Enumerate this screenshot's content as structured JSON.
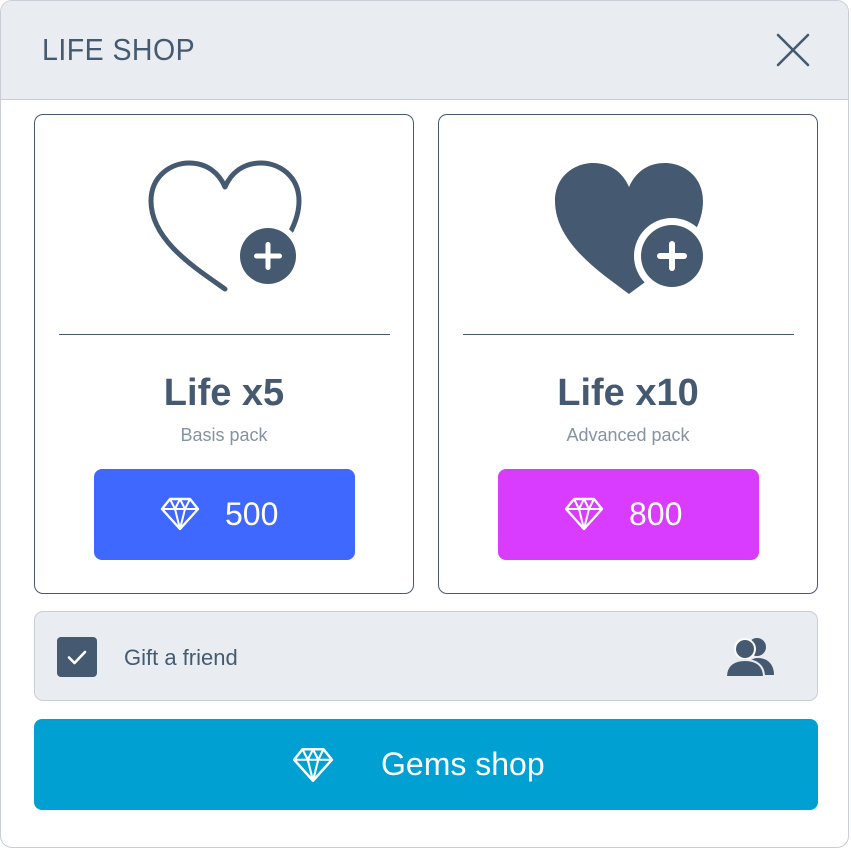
{
  "dialog": {
    "title": "LIFE SHOP",
    "close_icon": "close-icon"
  },
  "colors": {
    "header_bg": "#e9edf2",
    "text_primary": "#455a70",
    "text_muted": "#8593a3",
    "basis_button": "#3e68ff",
    "advanced_button": "#d93bff",
    "gems_button": "#00a0d2"
  },
  "packs": [
    {
      "name": "Life x5",
      "subtitle": "Basis pack",
      "price": "500",
      "icon": "heart-outline-plus-icon",
      "currency_icon": "gem-icon"
    },
    {
      "name": "Life x10",
      "subtitle": "Advanced pack",
      "price": "800",
      "icon": "heart-filled-plus-icon",
      "currency_icon": "gem-icon"
    }
  ],
  "gift": {
    "label": "Gift a friend",
    "checked": true,
    "icon": "friends-icon"
  },
  "gems_shop": {
    "label": "Gems shop",
    "icon": "gem-icon"
  }
}
